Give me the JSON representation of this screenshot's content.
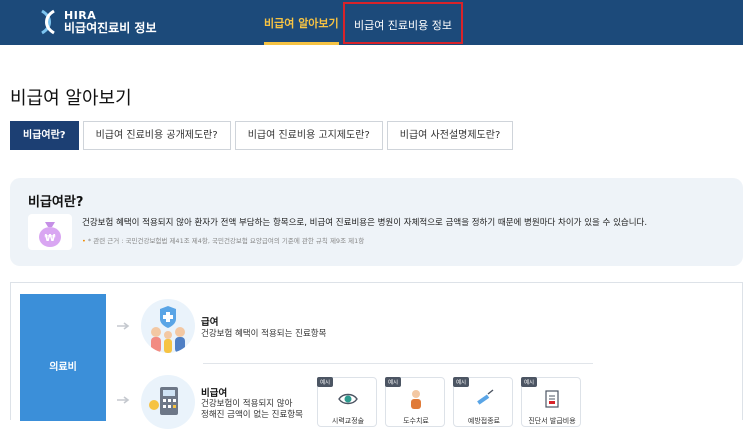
{
  "header": {
    "logo_en": "HIRA",
    "logo_ko": "비급여진료비 정보",
    "nav": [
      "비급여 알아보기",
      "비급여 진료비용 정보"
    ]
  },
  "page_title": "비급여 알아보기",
  "tabs": [
    "비급여란?",
    "비급여 진료비용 공개제도란?",
    "비급여 진료비용 고지제도란?",
    "비급여 사전설명제도란?"
  ],
  "info": {
    "title": "비급여란?",
    "description": "건강보험 혜택이 적용되지 않아 환자가 전액 부담하는 항목으로, 비급여 진료비용은 병원이 자체적으로 금액을 정하기 때문에 병원마다 차이가 있을 수 있습니다.",
    "note": "* 관련 근거 : 국민건강보험법 제41조 제4항, 국민건강보험 요양급여의 기준에 관한 규칙 제9조 제1항"
  },
  "diagram": {
    "medical_fee": "의료비",
    "covered": {
      "title": "급여",
      "desc": "건강보험 혜택이 적용되는 진료항목"
    },
    "non_covered": {
      "title": "비급여",
      "desc_line1": "건강보험이 적용되지 않아",
      "desc_line2": "정해진 금액이 없는 진료항목"
    },
    "example_tag": "예시",
    "examples": [
      "시력교정술",
      "도수치료",
      "예방접종료",
      "진단서 발급비용"
    ]
  },
  "colors": {
    "header_bg": "#1c4a7a",
    "nav_active": "#f6c343",
    "highlight_border": "#d8232a",
    "tab_active": "#1c3f73",
    "medical_box": "#3b8fd9"
  }
}
